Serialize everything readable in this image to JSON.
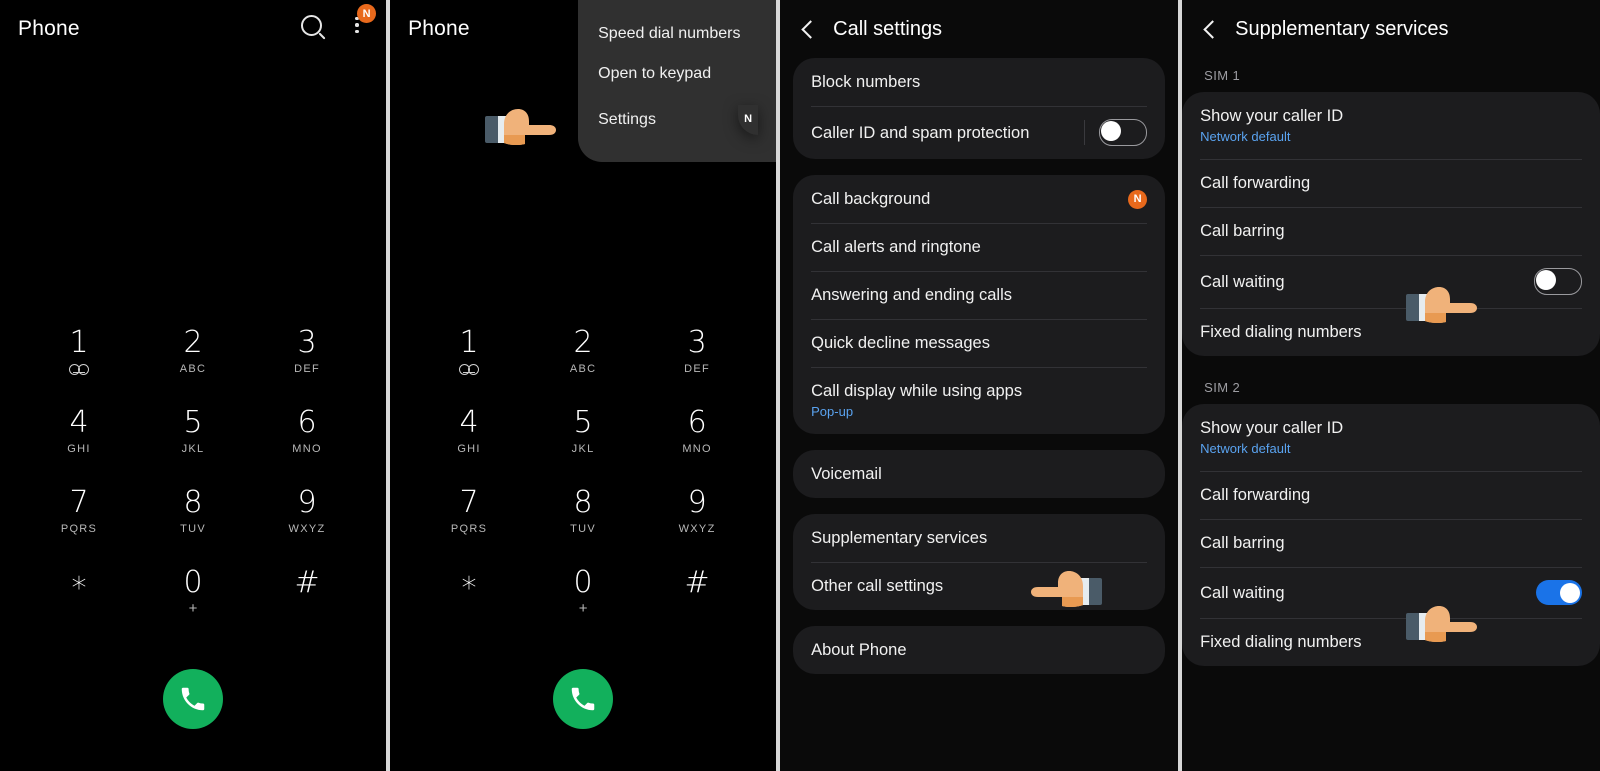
{
  "panel1": {
    "title": "Phone",
    "search_icon": "search-icon",
    "more_icon": "more-vertical-icon",
    "badge": "N",
    "keys": [
      {
        "num": "1",
        "sub": "voicemail-icon"
      },
      {
        "num": "2",
        "sub": "ABC"
      },
      {
        "num": "3",
        "sub": "DEF"
      },
      {
        "num": "4",
        "sub": "GHI"
      },
      {
        "num": "5",
        "sub": "JKL"
      },
      {
        "num": "6",
        "sub": "MNO"
      },
      {
        "num": "7",
        "sub": "PQRS"
      },
      {
        "num": "8",
        "sub": "TUV"
      },
      {
        "num": "9",
        "sub": "WXYZ"
      },
      {
        "num": "∗",
        "sub": ""
      },
      {
        "num": "0",
        "sub": "+"
      },
      {
        "num": "#",
        "sub": ""
      }
    ],
    "call_button": "call-button"
  },
  "panel2": {
    "title": "Phone",
    "menu": {
      "items": [
        {
          "label": "Speed dial numbers",
          "badge": ""
        },
        {
          "label": "Open to keypad",
          "badge": ""
        },
        {
          "label": "Settings",
          "badge": "N"
        }
      ]
    },
    "keys": [
      {
        "num": "1",
        "sub": "voicemail-icon"
      },
      {
        "num": "2",
        "sub": "ABC"
      },
      {
        "num": "3",
        "sub": "DEF"
      },
      {
        "num": "4",
        "sub": "GHI"
      },
      {
        "num": "5",
        "sub": "JKL"
      },
      {
        "num": "6",
        "sub": "MNO"
      },
      {
        "num": "7",
        "sub": "PQRS"
      },
      {
        "num": "8",
        "sub": "TUV"
      },
      {
        "num": "9",
        "sub": "WXYZ"
      },
      {
        "num": "∗",
        "sub": ""
      },
      {
        "num": "0",
        "sub": "+"
      },
      {
        "num": "#",
        "sub": ""
      }
    ],
    "call_button": "call-button"
  },
  "panel3": {
    "title": "Call settings",
    "back_icon": "back-chevron-icon",
    "group1": [
      {
        "label": "Block numbers",
        "sublabel": "",
        "toggle": null,
        "badge": ""
      },
      {
        "label": "Caller ID and spam protection",
        "sublabel": "",
        "toggle": "off",
        "badge": ""
      }
    ],
    "group2": [
      {
        "label": "Call background",
        "sublabel": "",
        "toggle": null,
        "badge": "N"
      },
      {
        "label": "Call alerts and ringtone",
        "sublabel": "",
        "toggle": null,
        "badge": ""
      },
      {
        "label": "Answering and ending calls",
        "sublabel": "",
        "toggle": null,
        "badge": ""
      },
      {
        "label": "Quick decline messages",
        "sublabel": "",
        "toggle": null,
        "badge": ""
      },
      {
        "label": "Call display while using apps",
        "sublabel": "Pop-up",
        "toggle": null,
        "badge": ""
      }
    ],
    "group3": [
      {
        "label": "Voicemail",
        "sublabel": "",
        "toggle": null,
        "badge": ""
      }
    ],
    "group4": [
      {
        "label": "Supplementary services",
        "sublabel": "",
        "toggle": null,
        "badge": ""
      },
      {
        "label": "Other call settings",
        "sublabel": "",
        "toggle": null,
        "badge": ""
      }
    ],
    "group5": [
      {
        "label": "About Phone",
        "sublabel": "",
        "toggle": null,
        "badge": ""
      }
    ]
  },
  "panel4": {
    "title": "Supplementary services",
    "back_icon": "back-chevron-icon",
    "sim1_label": "SIM 1",
    "sim1": [
      {
        "label": "Show your caller ID",
        "sublabel": "Network default",
        "toggle": null
      },
      {
        "label": "Call forwarding",
        "sublabel": "",
        "toggle": null
      },
      {
        "label": "Call barring",
        "sublabel": "",
        "toggle": null
      },
      {
        "label": "Call waiting",
        "sublabel": "",
        "toggle": "off"
      },
      {
        "label": "Fixed dialing numbers",
        "sublabel": "",
        "toggle": null
      }
    ],
    "sim2_label": "SIM 2",
    "sim2": [
      {
        "label": "Show your caller ID",
        "sublabel": "Network default",
        "toggle": null
      },
      {
        "label": "Call forwarding",
        "sublabel": "",
        "toggle": null
      },
      {
        "label": "Call barring",
        "sublabel": "",
        "toggle": null
      },
      {
        "label": "Call waiting",
        "sublabel": "",
        "toggle": "on"
      },
      {
        "label": "Fixed dialing numbers",
        "sublabel": "",
        "toggle": null
      }
    ]
  },
  "colors": {
    "accent_badge": "#e8691c",
    "toggle_on": "#1a73e8",
    "call_green": "#12b05c",
    "link_blue": "#5aa3f0",
    "card_bg": "#1c1c1e"
  }
}
